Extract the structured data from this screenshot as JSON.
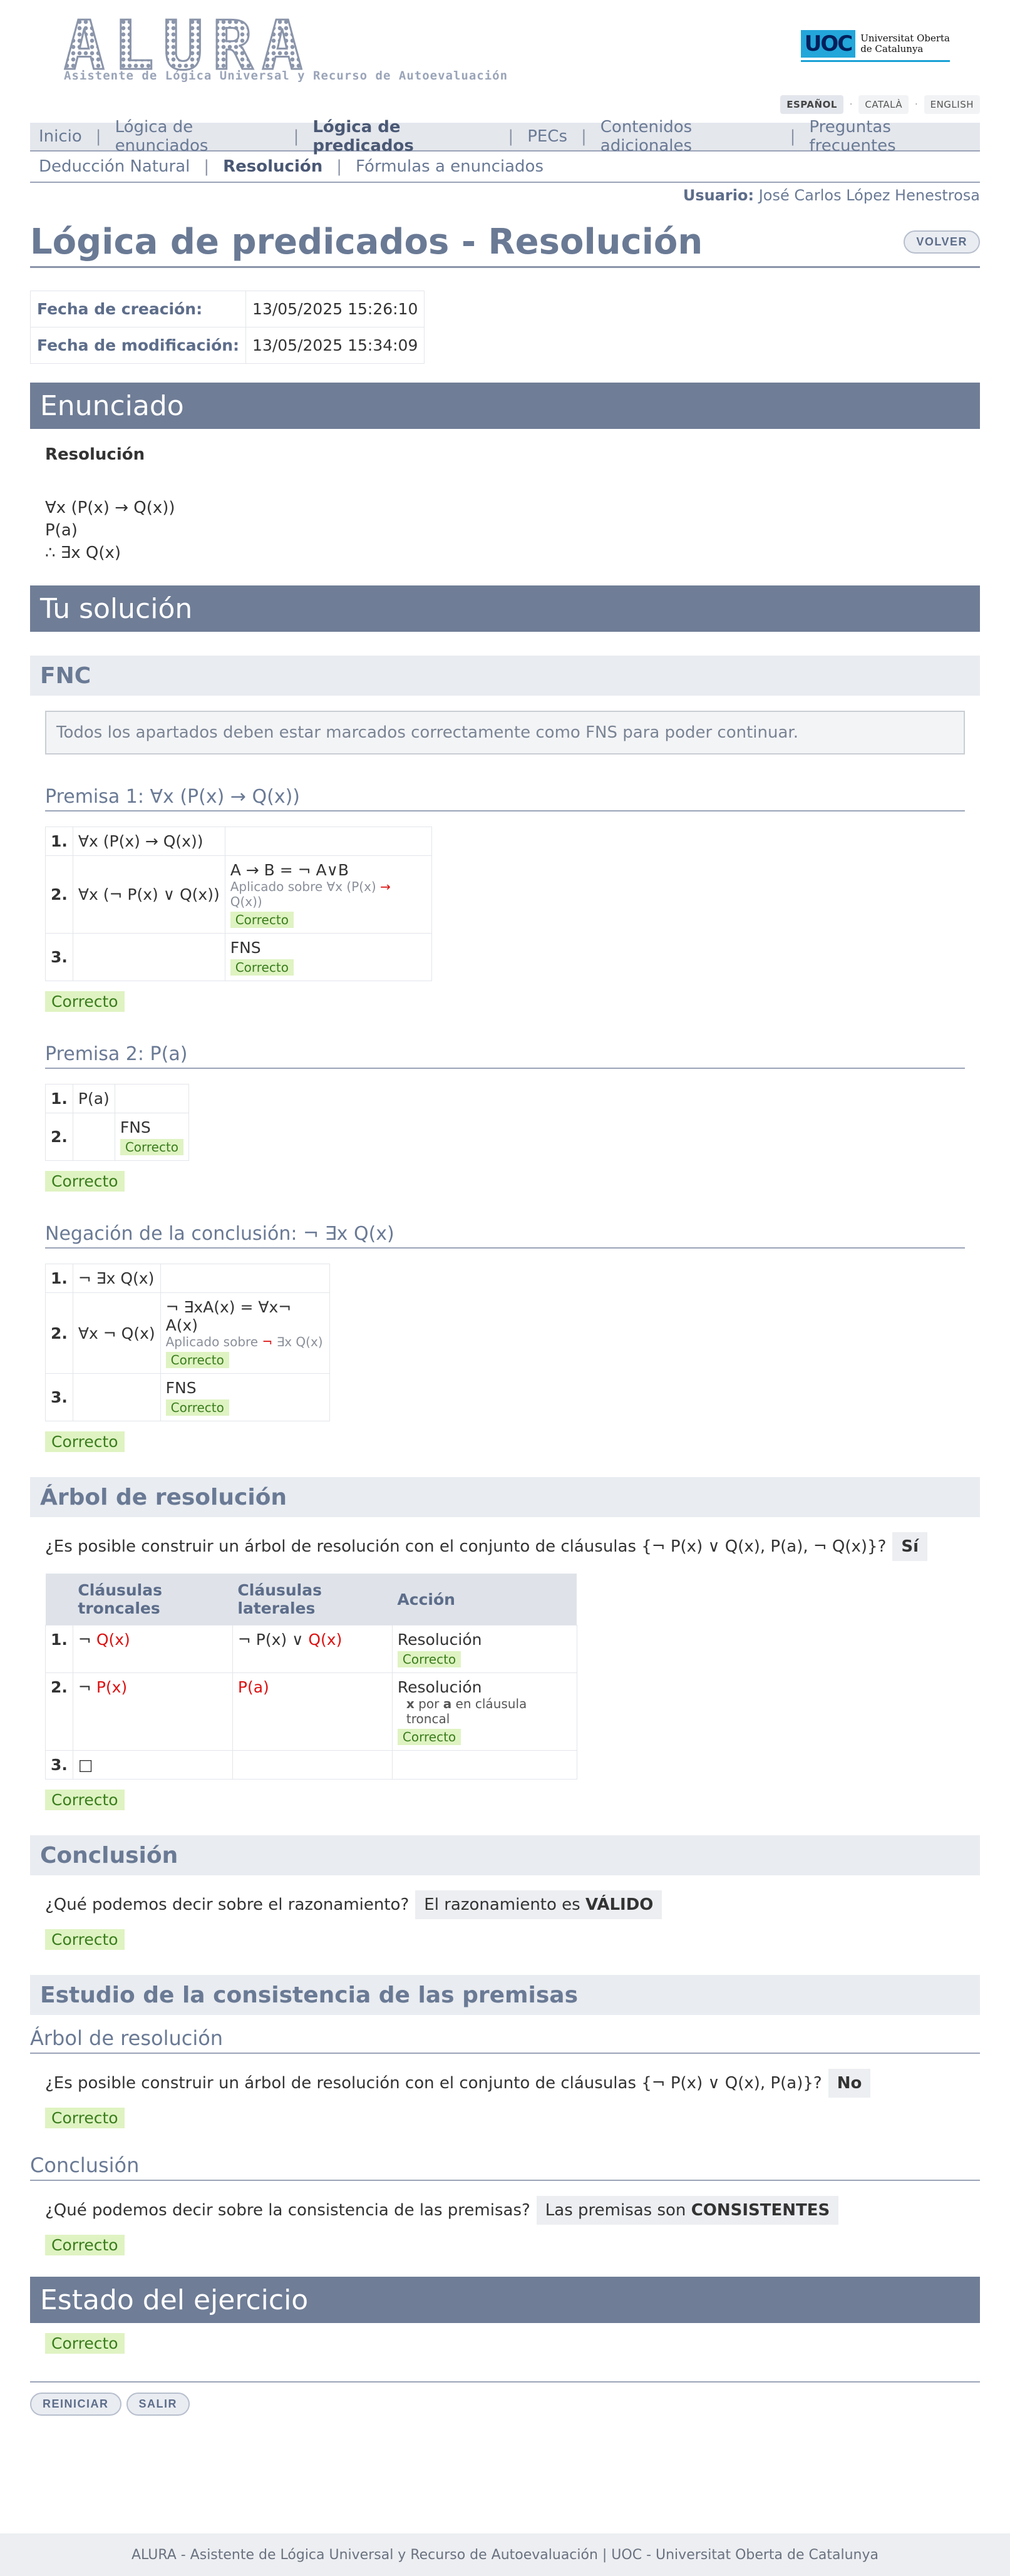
{
  "header": {
    "logo": "ALURA",
    "subtitle": "Asistente de Lógica Universal y Recurso de Autoevaluación",
    "uoc_mark": "UOC",
    "uoc_line1": "Universitat Oberta",
    "uoc_line2": "de Catalunya"
  },
  "lang": {
    "es": "ESPAÑOL",
    "ca": "CATALÀ",
    "en": "ENGLISH"
  },
  "nav": {
    "items": [
      "Inicio",
      "Lógica de enunciados",
      "Lógica de predicados",
      "PECs",
      "Contenidos adicionales",
      "Preguntas frecuentes"
    ],
    "sub_items": [
      "Deducción Natural",
      "Resolución",
      "Fórmulas a enunciados"
    ]
  },
  "user": {
    "label": "Usuario:",
    "name": "José Carlos López Henestrosa"
  },
  "page": {
    "title": "Lógica de predicados - Resolución",
    "back": "VOLVER"
  },
  "dates": {
    "created_label": "Fecha de creación:",
    "created": "13/05/2025 15:26:10",
    "modified_label": "Fecha de modificación:",
    "modified": "13/05/2025 15:34:09"
  },
  "enunciado": {
    "band": "Enunciado",
    "title": "Resolución",
    "lines": [
      "∀x (P(x) → Q(x))",
      "P(a)",
      "∴ ∃x Q(x)"
    ]
  },
  "solucion": {
    "band": "Tu solución",
    "fnc": "FNC",
    "notice": "Todos los apartados deben estar marcados correctamente como FNS para poder continuar."
  },
  "premisa1": {
    "heading": "Premisa 1: ∀x (P(x) → Q(x))",
    "rows": [
      {
        "n": "1.",
        "f": "∀x (P(x) → Q(x))"
      },
      {
        "n": "2.",
        "f": "∀x (¬ P(x) ∨ Q(x))",
        "rule": "A → B = ¬ A∨B",
        "applied": "Aplicado sobre ∀x (P(x) ",
        "applied_red": "→",
        "applied_tail": " Q(x))",
        "ok": "Correcto"
      },
      {
        "n": "3.",
        "f": "",
        "rule": "FNS",
        "ok": "Correcto"
      }
    ],
    "result": "Correcto"
  },
  "premisa2": {
    "heading": "Premisa 2: P(a)",
    "rows": [
      {
        "n": "1.",
        "f": "P(a)"
      },
      {
        "n": "2.",
        "f": "",
        "rule": "FNS",
        "ok": "Correcto"
      }
    ],
    "result": "Correcto"
  },
  "negacion": {
    "heading": "Negación de la conclusión: ¬ ∃x Q(x)",
    "rows": [
      {
        "n": "1.",
        "f": "¬ ∃x Q(x)"
      },
      {
        "n": "2.",
        "f": "∀x ¬ Q(x)",
        "rule": "¬ ∃xA(x) = ∀x¬ A(x)",
        "applied": "Aplicado sobre ",
        "applied_red": "¬",
        "applied_tail": " ∃x Q(x)",
        "ok": "Correcto"
      },
      {
        "n": "3.",
        "f": "",
        "rule": "FNS",
        "ok": "Correcto"
      }
    ],
    "result": "Correcto"
  },
  "arbol": {
    "band": "Árbol de resolución",
    "question": "¿Es posible construir un árbol de resolución con el conjunto de cláusulas {¬ P(x) ∨ Q(x), P(a), ¬ Q(x)}?",
    "answer": "Sí",
    "headers": [
      "Cláusulas troncales",
      "Cláusulas laterales",
      "Acción"
    ],
    "rows": [
      {
        "n": "1.",
        "t1": "¬ ",
        "t1r": "Q(x)",
        "l1": "¬ P(x) ∨ ",
        "l1r": "Q(x)",
        "a": "Resolución",
        "ok": "Correcto"
      },
      {
        "n": "2.",
        "t1": "¬ ",
        "t1r": "P(x)",
        "l1": "",
        "l1r": "P(a)",
        "a": "Resolución",
        "note_var": "x",
        "note_mid": " por ",
        "note_const": "a",
        "note_tail": " en cláusula troncal",
        "ok": "Correcto"
      },
      {
        "n": "3.",
        "t1": "□"
      }
    ],
    "result": "Correcto"
  },
  "conclusion": {
    "band": "Conclusión",
    "question": "¿Qué podemos decir sobre el razonamiento?",
    "answer_pre": "El razonamiento es ",
    "answer_bold": "VÁLIDO",
    "result": "Correcto"
  },
  "consistencia": {
    "band": "Estudio de la consistencia de las premisas",
    "sub1": "Árbol de resolución",
    "q1": "¿Es posible construir un árbol de resolución con el conjunto de cláusulas {¬ P(x) ∨ Q(x), P(a)}?",
    "a1": "No",
    "r1": "Correcto",
    "sub2": "Conclusión",
    "q2": "¿Qué podemos decir sobre la consistencia de las premisas?",
    "a2_pre": "Las premisas son ",
    "a2_bold": "CONSISTENTES",
    "r2": "Correcto"
  },
  "estado": {
    "band": "Estado del ejercicio",
    "result": "Correcto"
  },
  "buttons": {
    "reset": "REINICIAR",
    "exit": "SALIR"
  },
  "footer": "ALURA - Asistente de Lógica Universal y Recurso de Autoevaluación | UOC - Universitat Oberta de Catalunya"
}
